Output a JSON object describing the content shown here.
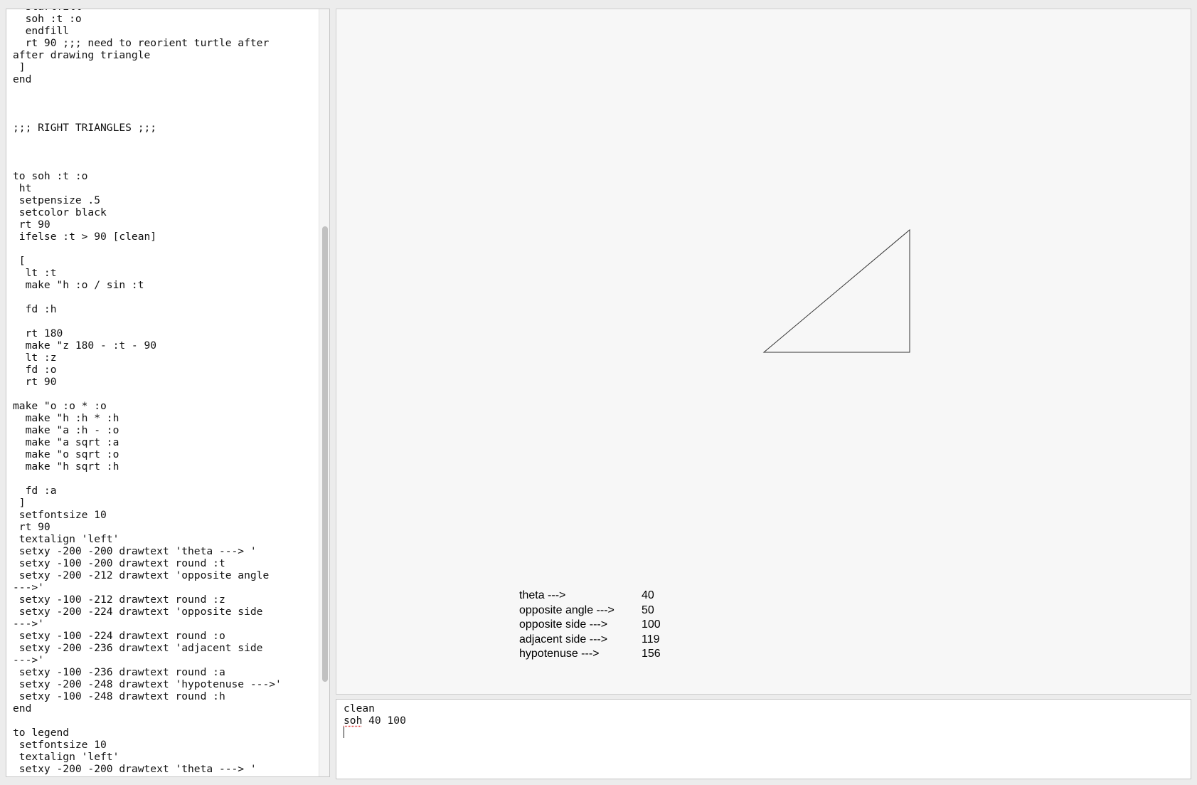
{
  "editor": {
    "lines": [
      "  startfill",
      "  soh :t :o",
      "  endfill",
      "  rt 90 ;;; need to reorient turtle after",
      "after drawing triangle",
      " ]",
      "end",
      "",
      "",
      "",
      ";;; RIGHT TRIANGLES ;;;",
      "",
      "",
      "",
      "to soh :t :o",
      " ht",
      " setpensize .5",
      " setcolor black",
      " rt 90",
      " ifelse :t > 90 [clean]",
      "",
      " [",
      "  lt :t",
      "  make \"h :o / sin :t",
      "",
      "  fd :h",
      "",
      "  rt 180",
      "  make \"z 180 - :t - 90",
      "  lt :z",
      "  fd :o",
      "  rt 90",
      "",
      "make \"o :o * :o",
      "  make \"h :h * :h",
      "  make \"a :h - :o",
      "  make \"a sqrt :a",
      "  make \"o sqrt :o",
      "  make \"h sqrt :h",
      "",
      "  fd :a",
      " ]",
      " setfontsize 10",
      " rt 90",
      " textalign 'left'",
      " setxy -200 -200 drawtext 'theta ---> '",
      " setxy -100 -200 drawtext round :t",
      " setxy -200 -212 drawtext 'opposite angle",
      "--->'",
      " setxy -100 -212 drawtext round :z",
      " setxy -200 -224 drawtext 'opposite side",
      "--->'",
      " setxy -100 -224 drawtext round :o",
      " setxy -200 -236 drawtext 'adjacent side",
      "--->'",
      " setxy -100 -236 drawtext round :a",
      " setxy -200 -248 drawtext 'hypotenuse --->'",
      " setxy -100 -248 drawtext round :h",
      "end",
      "",
      "to legend",
      " setfontsize 10",
      " textalign 'left'",
      " setxy -200 -200 drawtext 'theta ---> '"
    ]
  },
  "canvas": {
    "stroke_color": "#333333",
    "legend": [
      {
        "label": "theta --->",
        "value": "40"
      },
      {
        "label": "opposite angle --->",
        "value": "50"
      },
      {
        "label": "opposite side --->",
        "value": "100"
      },
      {
        "label": "adjacent side --->",
        "value": "119"
      },
      {
        "label": "hypotenuse --->",
        "value": "156"
      }
    ]
  },
  "console": {
    "line1": "clean",
    "line2_cmd": "soh",
    "line2_args": " 40 100"
  }
}
